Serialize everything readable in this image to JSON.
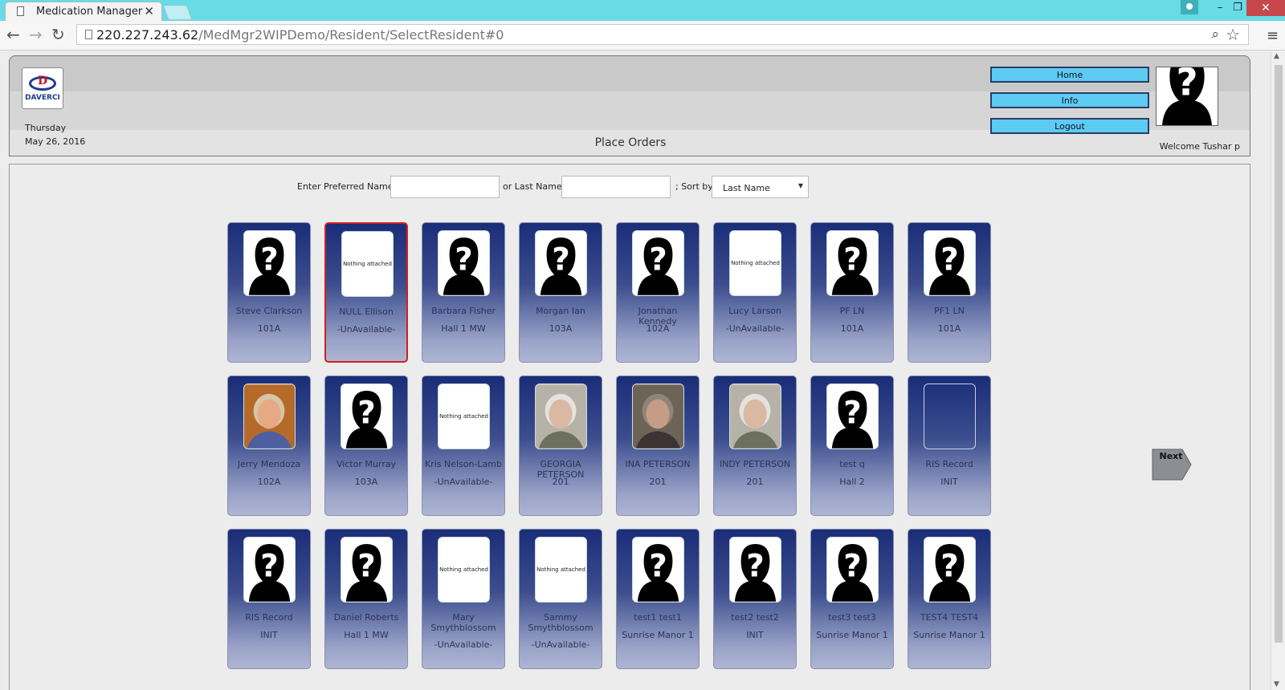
{
  "browser": {
    "tab_title": "Medication Manager",
    "tab_close": "✕",
    "url_host": "220.227.243.62",
    "url_path": "/MedMgr2WIPDemo/Resident/SelectResident#0"
  },
  "header": {
    "logo_text": "DAVERCI",
    "day": "Thursday",
    "date": "May 26, 2016",
    "title": "Place Orders",
    "buttons": {
      "home": "Home",
      "info": "Info",
      "logout": "Logout"
    },
    "welcome": "Welcome Tushar p"
  },
  "search": {
    "preferred_label": "Enter Preferred Name",
    "last_label": "or Last Name",
    "sort_label": "; Sort by",
    "sort_value": "Last Name",
    "preferred_value": "",
    "last_value": ""
  },
  "next_label": "Next",
  "residents": [
    {
      "name": "Steve Clarkson",
      "room": "101A",
      "photo": "silhouette"
    },
    {
      "name": "NULL Ellison",
      "room": "-UnAvailable-",
      "photo": "nothing",
      "selected": true
    },
    {
      "name": "Barbara Fisher",
      "room": "Hall 1 MW",
      "photo": "silhouette"
    },
    {
      "name": "Morgan Ian",
      "room": "103A",
      "photo": "silhouette"
    },
    {
      "name": "Jonathan Kennedy",
      "room": "102A",
      "photo": "silhouette"
    },
    {
      "name": "Lucy Larson",
      "room": "-UnAvailable-",
      "photo": "nothing"
    },
    {
      "name": "PF LN",
      "room": "101A",
      "photo": "silhouette"
    },
    {
      "name": "PF1 LN",
      "room": "101A",
      "photo": "silhouette"
    },
    {
      "name": "Jerry Mendoza",
      "room": "102A",
      "photo": "portrait-warm"
    },
    {
      "name": "Victor Murray",
      "room": "103A",
      "photo": "silhouette"
    },
    {
      "name": "Kris Nelson-Lamb",
      "room": "-UnAvailable-",
      "photo": "nothing"
    },
    {
      "name": "GEORGIA PETERSON",
      "room": "201",
      "photo": "portrait-gray"
    },
    {
      "name": "INA PETERSON",
      "room": "201",
      "photo": "portrait-brown"
    },
    {
      "name": "INDY PETERSON",
      "room": "201",
      "photo": "portrait-gray"
    },
    {
      "name": "test q",
      "room": "Hall 2",
      "photo": "silhouette"
    },
    {
      "name": "RIS Record",
      "room": "INIT",
      "photo": "blank"
    },
    {
      "name": "RIS Record",
      "room": "INIT",
      "photo": "silhouette"
    },
    {
      "name": "Daniel Roberts",
      "room": "Hall 1 MW",
      "photo": "silhouette"
    },
    {
      "name": "Mary Smythblossom",
      "room": "-UnAvailable-",
      "photo": "nothing"
    },
    {
      "name": "Sammy Smythblossom",
      "room": "-UnAvailable-",
      "photo": "nothing"
    },
    {
      "name": "test1 test1",
      "room": "Sunrise Manor 1",
      "photo": "silhouette"
    },
    {
      "name": "test2 test2",
      "room": "INIT",
      "photo": "silhouette"
    },
    {
      "name": "test3 test3",
      "room": "Sunrise Manor 1",
      "photo": "silhouette"
    },
    {
      "name": "TEST4 TEST4",
      "room": "Sunrise Manor 1",
      "photo": "silhouette"
    }
  ],
  "nothing_attached_text": "Nothing attached",
  "colors": {
    "titlebar": "#67dbe6",
    "button": "#5ecbf2",
    "card_top": "#1a2d78",
    "card_bottom": "#aeb5d3",
    "selected_border": "#d41f1f"
  }
}
